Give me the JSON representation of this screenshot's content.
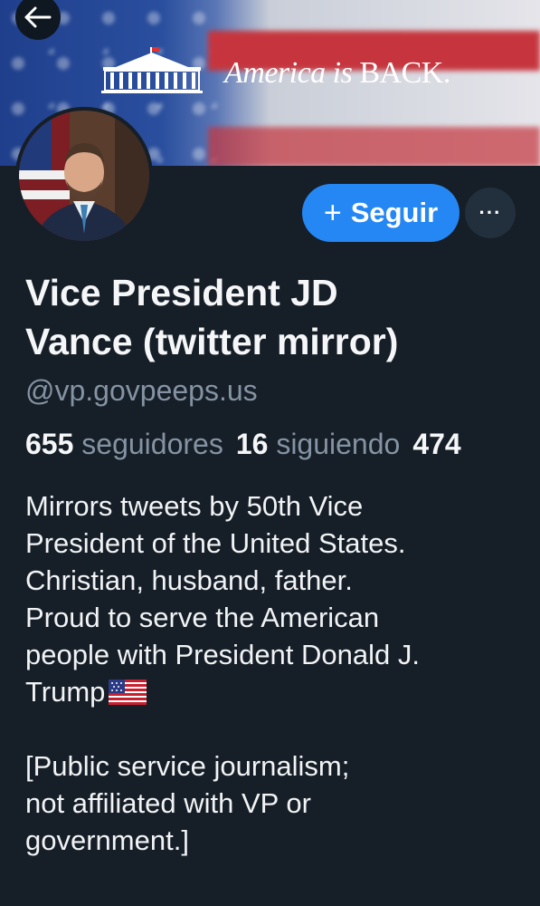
{
  "banner": {
    "slogan_main": "America is",
    "slogan_end": "BACK."
  },
  "actions": {
    "follow_plus": "+",
    "follow_label": "Seguir",
    "more_label": "···"
  },
  "profile": {
    "name_line1": "Vice President JD",
    "name_line2": "Vance (twitter mirror)",
    "handle": "@vp.govpeeps.us",
    "followers_count": "655",
    "followers_label": "seguidores",
    "following_count": "16",
    "following_label": "siguiendo",
    "posts_count": "474"
  },
  "bio": {
    "line1": "Mirrors tweets by 50th Vice",
    "line2": "President of the United States.",
    "line3": "Christian, husband, father.",
    "line4": "Proud to serve the American",
    "line5": "people with President Donald J.",
    "line6": "Trump",
    "line7": "[Public service journalism;",
    "line8": "not affiliated with VP or",
    "line9": "government.]"
  },
  "colors": {
    "background": "#161e27",
    "accent": "#2487f3",
    "muted_text": "#8493a3"
  },
  "icons": {
    "back": "arrow-left-icon",
    "flag": "us-flag-icon",
    "more": "ellipsis-icon"
  }
}
